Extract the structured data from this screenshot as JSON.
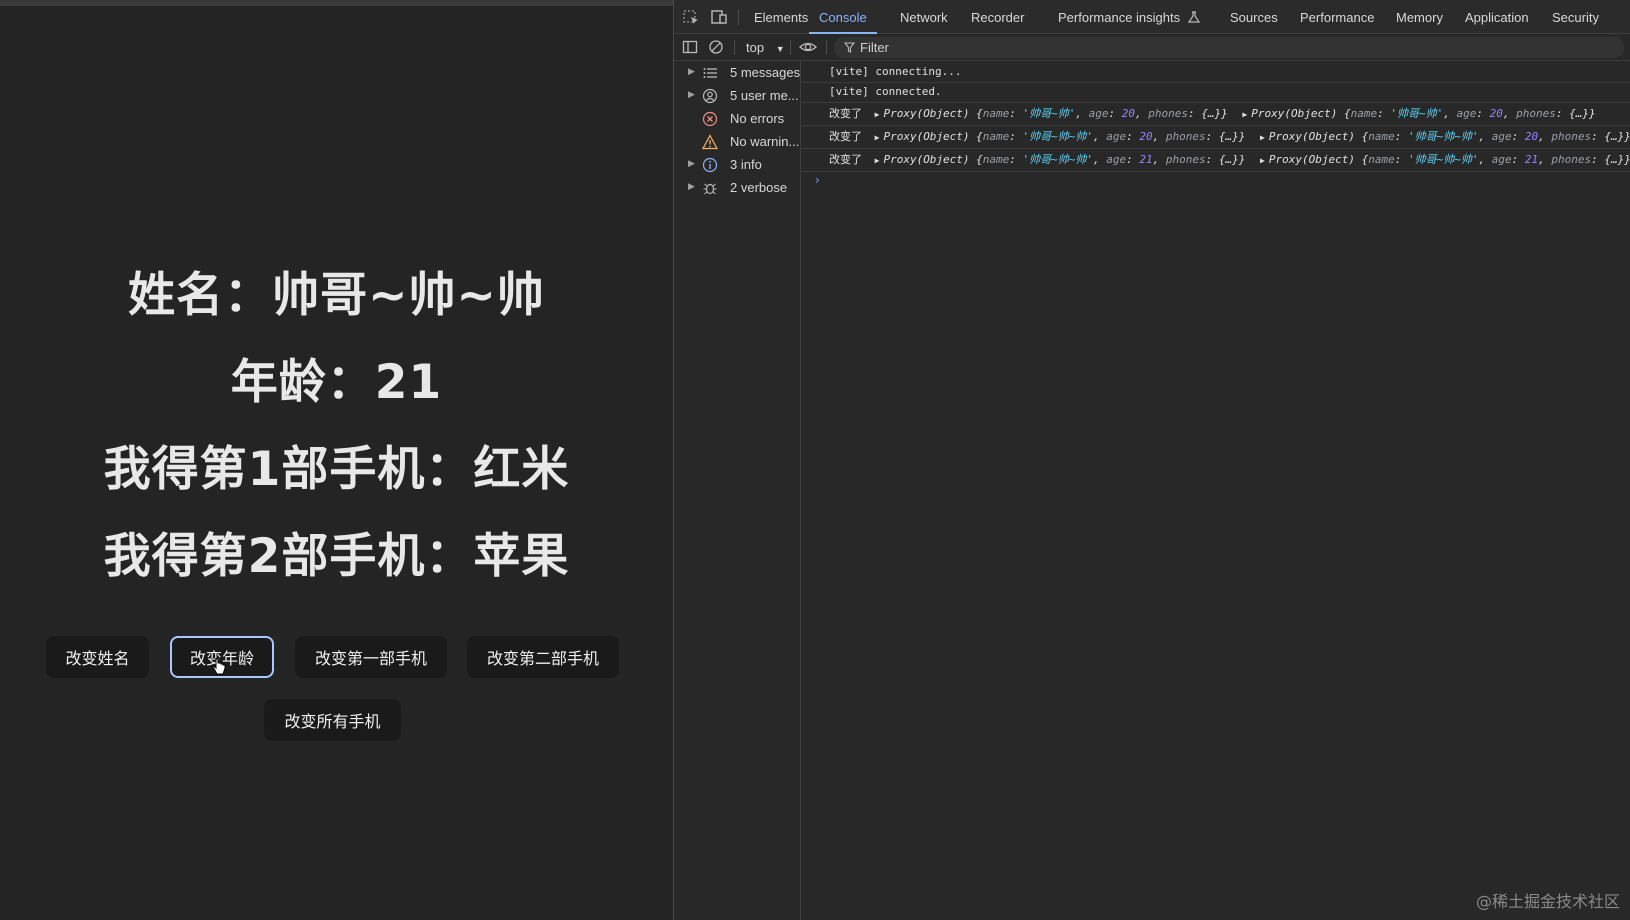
{
  "app": {
    "name_line": "姓名：帅哥~帅~帅",
    "age_line": "年龄：21",
    "phone1_line": "我得第1部手机：红米",
    "phone2_line": "我得第2部手机：苹果",
    "buttons": {
      "change_name": "改变姓名",
      "change_age": "改变年龄",
      "change_phone1": "改变第一部手机",
      "change_phone2": "改变第二部手机",
      "change_all_phones": "改变所有手机"
    }
  },
  "devtools": {
    "tabs": [
      "Elements",
      "Console",
      "Network",
      "Recorder",
      "Performance insights",
      "Sources",
      "Performance",
      "Memory",
      "Application",
      "Security"
    ],
    "active_tab": "Console",
    "toolbar": {
      "context": "top",
      "filter_placeholder": "Filter"
    },
    "sidebar": [
      {
        "label": "5 messages",
        "icon": "list-icon",
        "expandable": true
      },
      {
        "label": "5 user me...",
        "icon": "user-icon",
        "expandable": true
      },
      {
        "label": "No errors",
        "icon": "error-icon",
        "expandable": false
      },
      {
        "label": "No warnin...",
        "icon": "warning-icon",
        "expandable": false
      },
      {
        "label": "3 info",
        "icon": "info-icon",
        "expandable": true
      },
      {
        "label": "2 verbose",
        "icon": "bug-icon",
        "expandable": true
      }
    ],
    "logs": {
      "line1": "[vite] connecting...",
      "line2": "[vite] connected.",
      "prefix": "改变了",
      "proxy": "Proxy(Object)",
      "rows": [
        {
          "new_name": "'帅哥~帅'",
          "new_age": "20",
          "old_name": "'帅哥~帅'",
          "old_age": "20"
        },
        {
          "new_name": "'帅哥~帅~帅'",
          "new_age": "20",
          "old_name": "'帅哥~帅~帅'",
          "old_age": "20"
        },
        {
          "new_name": "'帅哥~帅~帅'",
          "new_age": "21",
          "old_name": "'帅哥~帅~帅'",
          "old_age": "21"
        }
      ],
      "phones_value": "{…}"
    }
  },
  "watermark": "@稀土掘金技术社区"
}
